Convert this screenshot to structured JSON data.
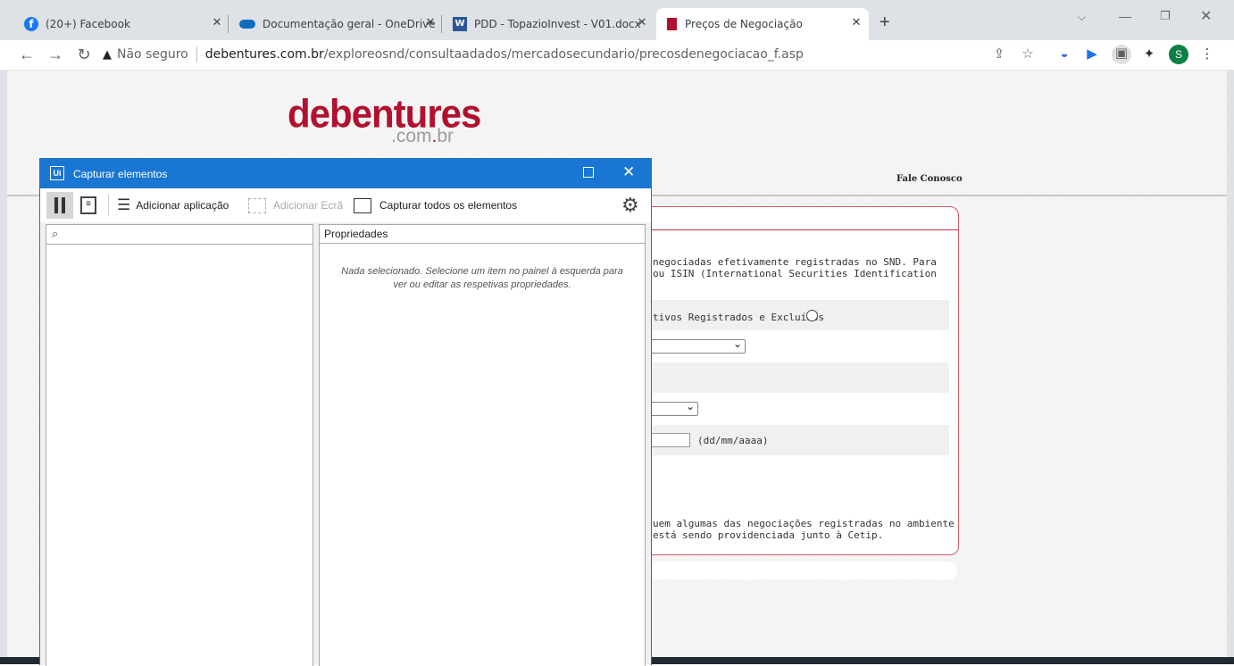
{
  "browser": {
    "tabs": [
      {
        "title": "(20+) Facebook",
        "icon": "facebook-icon"
      },
      {
        "title": "Documentação geral - OneDrive",
        "icon": "onedrive-icon"
      },
      {
        "title": "PDD - TopazioInvest - V01.docx",
        "icon": "word-icon"
      },
      {
        "title": "Preços de Negociação",
        "icon": "debentures-favicon"
      }
    ],
    "active_tab": 3,
    "new_tab": "+",
    "security": "Não seguro",
    "url_host": "debentures.com.br",
    "url_path": "/exploreosnd/consultaadados/mercadosecundario/precosdenegociacao_f.asp",
    "profile_initial": "S"
  },
  "site": {
    "logo": "debentures",
    "logo_sub_pre": ".com",
    "logo_sub_dot": ".",
    "logo_sub_post": "br",
    "nav_contact": "Fale Conosco",
    "intro_line1": "negociadas efetivamente registradas no SND. Para",
    "intro_line2": "ou ISIN (International Securities Identification",
    "radio_label": "tivos Registrados e Excluídos",
    "date_hint": "(dd/mm/aaaa)",
    "note_line1": "uem algumas das negociações registradas no ambiente",
    "note_line2": "está sendo providenciada junto à Cetip."
  },
  "dialog": {
    "title": "Capturar elementos",
    "app_badge": "Ui",
    "add_app": "Adicionar aplicação",
    "add_screen": "Adicionar Ecrã",
    "capture_all": "Capturar todos os elementos",
    "properties_header": "Propriedades",
    "empty_msg": "Nada selecionado. Selecione um item no painel à esquerda para ver ou editar as respetivas propriedades."
  }
}
